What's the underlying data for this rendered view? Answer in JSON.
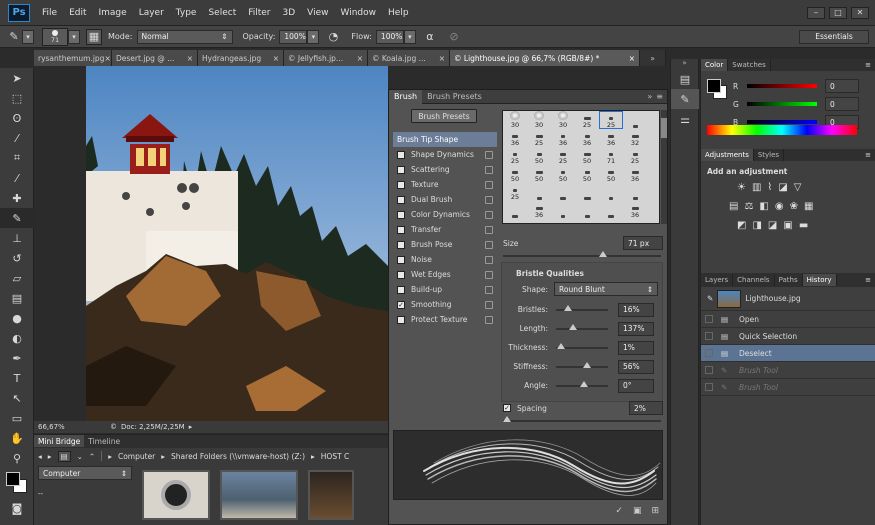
{
  "app": {
    "logo": "Ps"
  },
  "menu": [
    "File",
    "Edit",
    "Image",
    "Layer",
    "Type",
    "Select",
    "Filter",
    "3D",
    "View",
    "Window",
    "Help"
  ],
  "options": {
    "brush_size": "71",
    "mode_label": "Mode:",
    "mode_value": "Normal",
    "opacity_label": "Opacity:",
    "opacity_value": "100%",
    "flow_label": "Flow:",
    "flow_value": "100%",
    "workspace": "Essentials"
  },
  "tabs": [
    {
      "label": "rysanthemum.jpg",
      "close": "×"
    },
    {
      "label": "Desert.jpg @ ...",
      "close": "×"
    },
    {
      "label": "Hydrangeas.jpg",
      "close": "×"
    },
    {
      "label": "© Jellyfish.jp...",
      "close": "×"
    },
    {
      "label": "© Koala.jpg ...",
      "close": "×"
    },
    {
      "label": "© Lighthouse.jpg @ 66,7% (RGB/8#) *",
      "close": "×"
    }
  ],
  "status": {
    "zoom": "66,67%",
    "doc": "Doc: 2,25M/2,25M"
  },
  "minibridge": {
    "tab1": "Mini Bridge",
    "tab2": "Timeline",
    "path": [
      "Computer",
      "Shared Folders (\\\\vmware-host) (Z:)",
      "HOST C"
    ],
    "location": "Computer",
    "dash": "--"
  },
  "brush": {
    "tab1": "Brush",
    "tab2": "Brush Presets",
    "presets_button": "Brush Presets",
    "options": [
      {
        "label": "Brush Tip Shape",
        "checkbox": false,
        "lock": false,
        "highlight": true
      },
      {
        "label": "Shape Dynamics",
        "checkbox": true,
        "checked": false,
        "lock": true
      },
      {
        "label": "Scattering",
        "checkbox": true,
        "checked": false,
        "lock": true
      },
      {
        "label": "Texture",
        "checkbox": true,
        "checked": false,
        "lock": true
      },
      {
        "label": "Dual Brush",
        "checkbox": true,
        "checked": false,
        "lock": true
      },
      {
        "label": "Color Dynamics",
        "checkbox": true,
        "checked": false,
        "lock": true
      },
      {
        "label": "Transfer",
        "checkbox": true,
        "checked": false,
        "lock": true
      },
      {
        "label": "Brush Pose",
        "checkbox": true,
        "checked": false,
        "lock": true
      },
      {
        "label": "Noise",
        "checkbox": true,
        "checked": false,
        "lock": true
      },
      {
        "label": "Wet Edges",
        "checkbox": true,
        "checked": false,
        "lock": true
      },
      {
        "label": "Build-up",
        "checkbox": true,
        "checked": false,
        "lock": true
      },
      {
        "label": "Smoothing",
        "checkbox": true,
        "checked": true,
        "lock": true
      },
      {
        "label": "Protect Texture",
        "checkbox": true,
        "checked": false,
        "lock": true
      }
    ],
    "tip_sizes": [
      "30",
      "30",
      "30",
      "25",
      "25",
      "",
      "36",
      "25",
      "36",
      "36",
      "36",
      "32",
      "25",
      "50",
      "25",
      "50",
      "71",
      "25",
      "50",
      "50",
      "50",
      "50",
      "50",
      "36",
      "25",
      "",
      "",
      "",
      "",
      "",
      "",
      "36",
      "",
      "",
      "",
      "36",
      "",
      ""
    ],
    "size_label": "Size",
    "size_value": "71 px",
    "bristle_title": "Bristle Qualities",
    "shape_label": "Shape:",
    "shape_value": "Round Blunt",
    "sliders": [
      {
        "label": "Bristles:",
        "value": "16%",
        "pos": 0.16
      },
      {
        "label": "Length:",
        "value": "137%",
        "pos": 0.27
      },
      {
        "label": "Thickness:",
        "value": "1%",
        "pos": 0.02
      },
      {
        "label": "Stiffness:",
        "value": "56%",
        "pos": 0.56
      },
      {
        "label": "Angle:",
        "value": "0°",
        "pos": 0.5
      }
    ],
    "spacing_label": "Spacing",
    "spacing_value": "2%",
    "spacing_checked": true
  },
  "color": {
    "tab1": "Color",
    "tab2": "Swatches",
    "channels": [
      {
        "label": "R",
        "value": "0"
      },
      {
        "label": "G",
        "value": "0"
      },
      {
        "label": "B",
        "value": "0"
      }
    ]
  },
  "adjustments": {
    "tab1": "Adjustments",
    "tab2": "Styles",
    "title": "Add an adjustment"
  },
  "layers": {
    "tabs": [
      "Layers",
      "Channels",
      "Paths",
      "History"
    ],
    "snapshot": "Lighthouse.jpg",
    "history": [
      {
        "label": "Open",
        "state": "normal"
      },
      {
        "label": "Quick Selection",
        "state": "normal"
      },
      {
        "label": "Deselect",
        "state": "selected"
      },
      {
        "label": "Brush Tool",
        "state": "dim"
      },
      {
        "label": "Brush Tool",
        "state": "dim"
      }
    ]
  }
}
